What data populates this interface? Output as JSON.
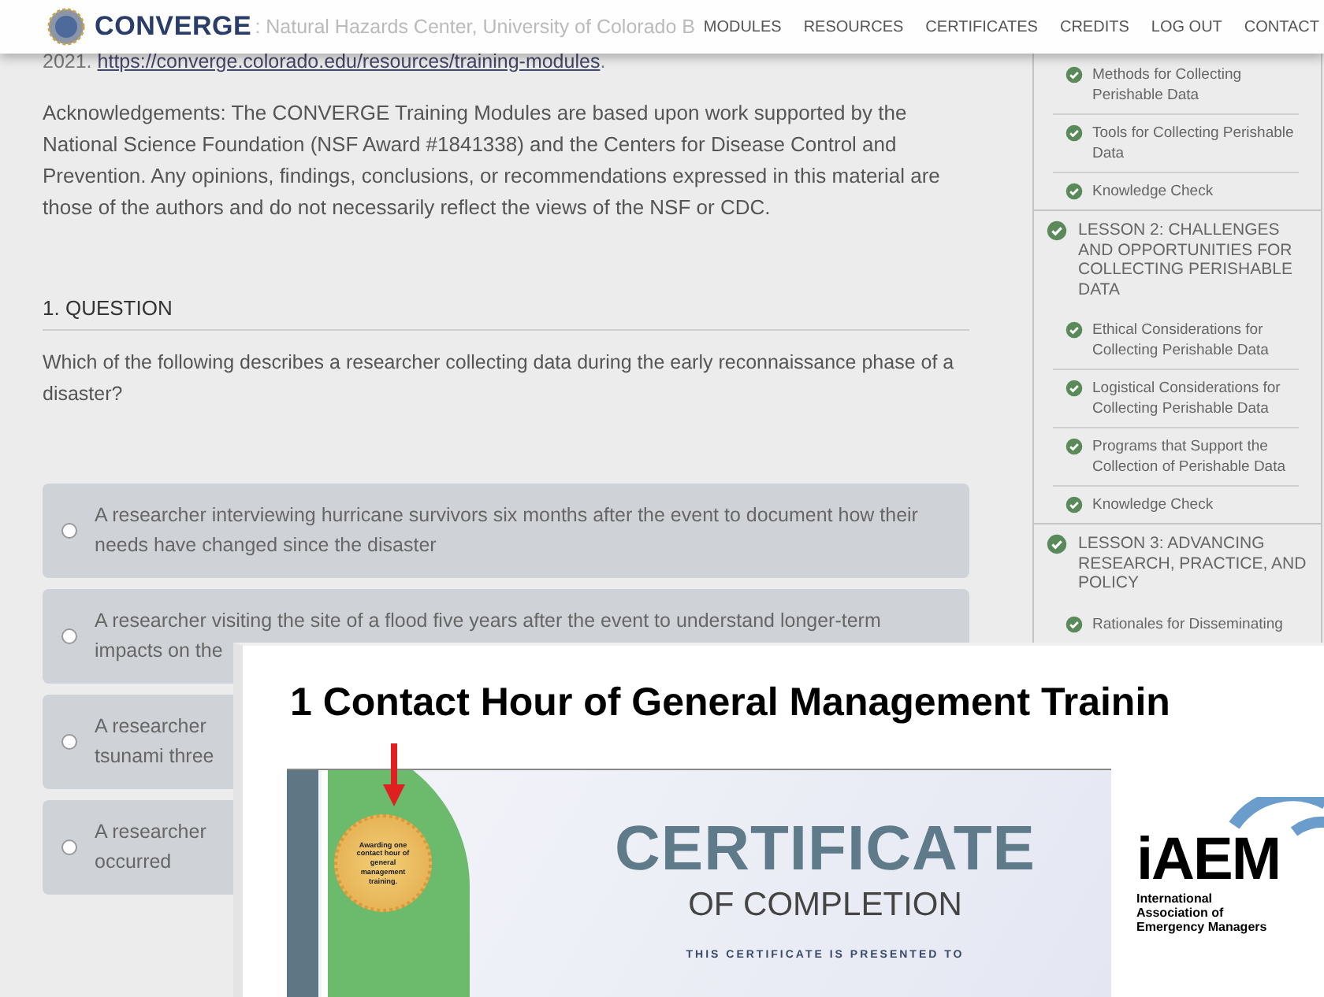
{
  "header": {
    "logo_text": "CONVERGE",
    "behind_text": ": Natural Hazards Center, University of Colorado B",
    "nav": [
      "MODULES",
      "RESOURCES",
      "CERTIFICATES",
      "CREDITS",
      "LOG OUT",
      "CONTACT"
    ]
  },
  "content": {
    "citation_prefix": "2021. ",
    "citation_link": "https://converge.colorado.edu/resources/training-modules",
    "citation_suffix": ".",
    "acknowledgements": "Acknowledgements: The CONVERGE Training Modules are based upon work supported by the National Science Foundation (NSF Award #1841338) and the Centers for Disease Control and Prevention. Any opinions, findings, conclusions, or recommendations expressed in this material are those of the authors and do not necessarily reflect the views of the NSF or CDC.",
    "question_heading": "1. QUESTION",
    "question": "Which of the following describes a researcher collecting data during the early reconnaissance phase of a disaster?",
    "options": [
      {
        "lines": [
          "A researcher interviewing hurricane survivors six months after the event to document how their",
          "needs have changed since the disaster"
        ],
        "selected": false
      },
      {
        "lines": [
          "A researcher visiting the site of a flood five years after the event to understand longer-term",
          "impacts on the"
        ],
        "selected": false
      },
      {
        "lines": [
          "A researcher",
          "tsunami three"
        ],
        "selected": false
      },
      {
        "lines": [
          "A researcher",
          "occurred"
        ],
        "selected": false
      }
    ]
  },
  "sidebar": {
    "items": [
      {
        "kind": "topic",
        "label": "Methods for Collecting Perishable Data",
        "completed": true
      },
      {
        "kind": "topic",
        "label": "Tools for Collecting Perishable Data",
        "completed": true
      },
      {
        "kind": "topic",
        "label": "Knowledge Check",
        "completed": true
      },
      {
        "kind": "lesson",
        "label": "LESSON 2: CHALLENGES AND OPPORTUNITIES FOR COLLECTING PERISHABLE DATA",
        "completed": true
      },
      {
        "kind": "topic",
        "label": "Ethical Considerations for Collecting Perishable Data",
        "completed": true
      },
      {
        "kind": "topic",
        "label": "Logistical Considerations for Collecting Perishable Data",
        "completed": true
      },
      {
        "kind": "topic",
        "label": "Programs that Support the Collection of Perishable Data",
        "completed": true
      },
      {
        "kind": "topic",
        "label": "Knowledge Check",
        "completed": true
      },
      {
        "kind": "lesson",
        "label": "LESSON 3: ADVANCING RESEARCH, PRACTICE, AND POLICY",
        "completed": true
      },
      {
        "kind": "topic",
        "label": "Rationales for Disseminating",
        "completed": true
      }
    ]
  },
  "overlay": {
    "title": "1 Contact Hour of General Management Trainin",
    "certificate": {
      "seal_text": "Awarding one contact hour of general management training.",
      "heading": "CERTIFICATE",
      "subheading": "OF COMPLETION",
      "presented_to": "THIS CERTIFICATE IS PRESENTED TO"
    },
    "iaem_logo": {
      "wordmark": "iAEM",
      "name_lines": [
        "International",
        "Association of",
        "Emergency Managers"
      ]
    }
  }
}
